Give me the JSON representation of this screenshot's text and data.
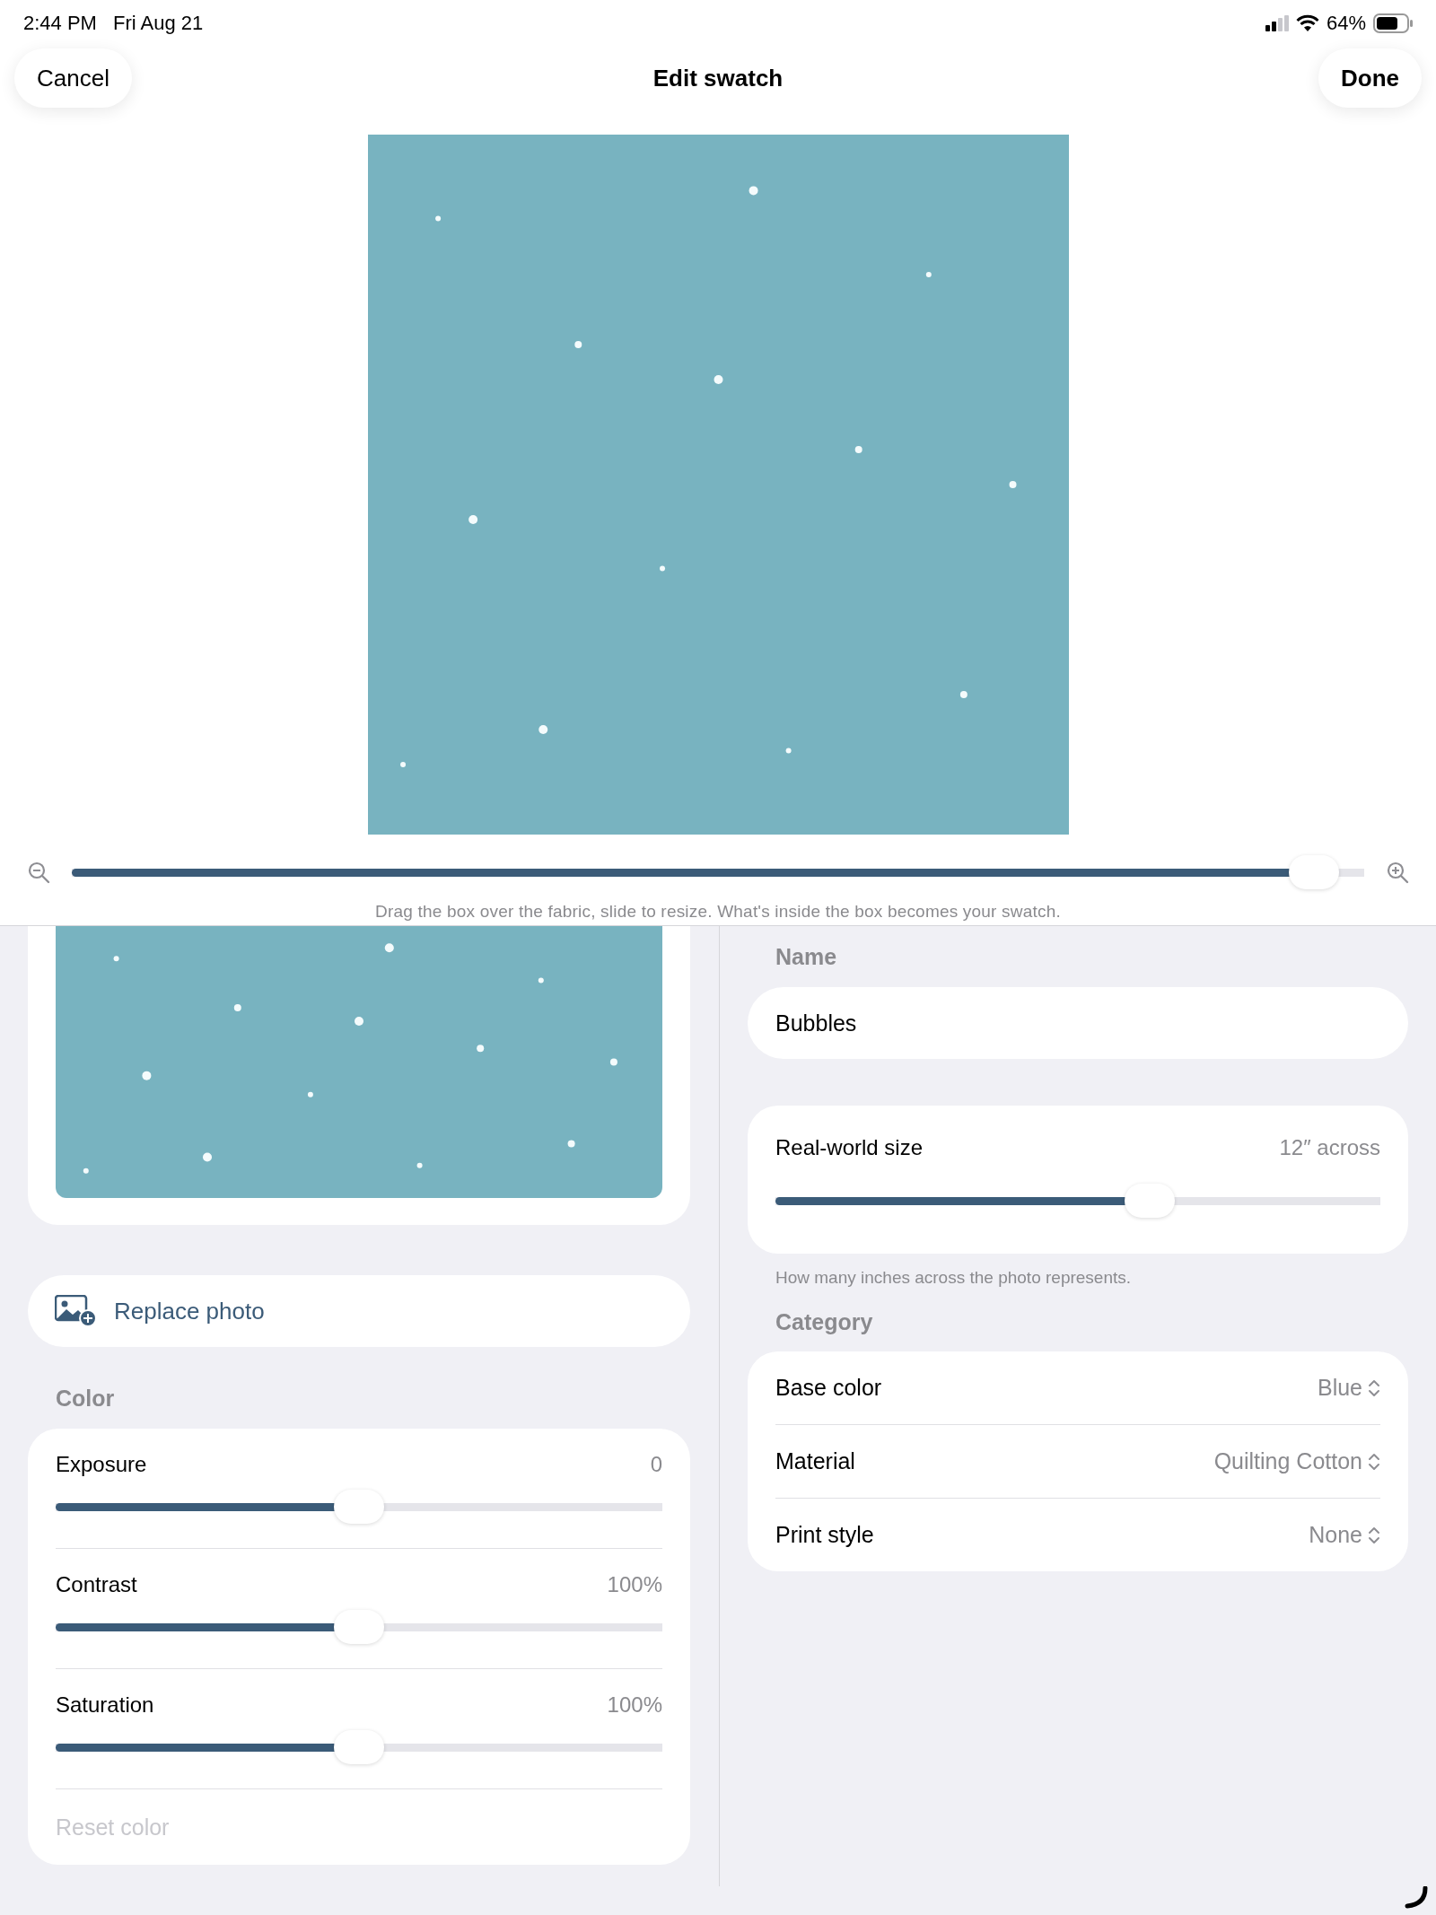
{
  "status_bar": {
    "time": "2:44 PM",
    "date": "Fri Aug 21",
    "battery": "64%"
  },
  "nav": {
    "cancel": "Cancel",
    "title": "Edit swatch",
    "done": "Done"
  },
  "crop": {
    "kind": "picture",
    "zoom_slider": {
      "level": 0.98
    },
    "caption": "Drag the box over the fabric, slide to resize. What's inside the box becomes your swatch."
  },
  "replace_button": "Replace photo",
  "color_section": {
    "header": "Color",
    "sliders": [
      {
        "label": "Exposure",
        "value": "0",
        "level": 0.5
      },
      {
        "label": "Contrast",
        "value": "100%",
        "level": 0.5
      },
      {
        "label": "Saturation",
        "value": "100%",
        "level": 0.5
      }
    ],
    "reset_button": {
      "label": "Reset color",
      "disabled": true
    }
  },
  "name_section": {
    "header": "Name",
    "value": "Bubbles"
  },
  "size_section": {
    "label": "Real-world size",
    "value": "12″ across",
    "level": 0.63,
    "hint": "How many inches across the photo represents."
  },
  "category_section": {
    "header": "Category",
    "rows": [
      {
        "label": "Base color",
        "value": "Blue"
      },
      {
        "label": "Material",
        "value": "Quilting Cotton"
      },
      {
        "label": "Print style",
        "value": "None"
      }
    ]
  }
}
